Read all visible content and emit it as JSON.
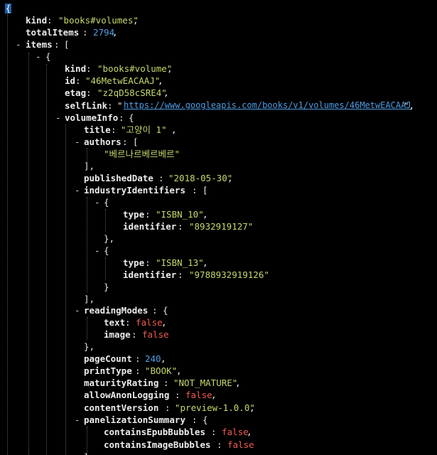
{
  "json": {
    "root_open": "{",
    "kind": {
      "key": "kind",
      "value": "\"books#volumes\""
    },
    "totalItems": {
      "key": "totalItems",
      "value": "2794"
    },
    "items": {
      "key": "items",
      "open": "[",
      "item0": {
        "open": "{",
        "kind": {
          "key": "kind",
          "value": "\"books#volume\""
        },
        "id": {
          "key": "id",
          "value": "\"46MetwEACAAJ\""
        },
        "etag": {
          "key": "etag",
          "value": "\"z2qD58cSRE4\""
        },
        "selfLink": {
          "key": "selfLink",
          "value": "https://www.googleapis.com/books/v1/volumes/46MetwEACAAJ"
        },
        "volumeInfo": {
          "key": "volumeInfo",
          "open": "{",
          "title": {
            "key": "title",
            "value": "\"고양이 1\""
          },
          "authors": {
            "key": "authors",
            "open": "[",
            "values": [
              "\"베르나르베르베르\""
            ],
            "close": "],"
          },
          "publishedDate": {
            "key": "publishedDate",
            "value": "\"2018-05-30\""
          },
          "industryIdentifiers": {
            "key": "industryIdentifiers",
            "open": "[",
            "entries": [
              {
                "open": "{",
                "type_key": "type",
                "type_value": "\"ISBN_10\"",
                "id_key": "identifier",
                "id_value": "\"8932919127\"",
                "close": "},"
              },
              {
                "open": "{",
                "type_key": "type",
                "type_value": "\"ISBN_13\"",
                "id_key": "identifier",
                "id_value": "\"9788932919126\"",
                "close": "}"
              }
            ],
            "close": "],"
          },
          "readingModes": {
            "key": "readingModes",
            "open": "{",
            "text": {
              "key": "text",
              "value": "false"
            },
            "image": {
              "key": "image",
              "value": "false"
            },
            "close": "},"
          },
          "pageCount": {
            "key": "pageCount",
            "value": "240"
          },
          "printType": {
            "key": "printType",
            "value": "\"BOOK\""
          },
          "maturityRating": {
            "key": "maturityRating",
            "value": "\"NOT_MATURE\""
          },
          "allowAnonLogging": {
            "key": "allowAnonLogging",
            "value": "false"
          },
          "contentVersion": {
            "key": "contentVersion",
            "value": "\"preview-1.0.0\""
          },
          "panelizationSummary": {
            "key": "panelizationSummary",
            "open": "{",
            "containsEpubBubbles": {
              "key": "containsEpubBubbles",
              "value": "false"
            },
            "containsImageBubbles": {
              "key": "containsImageBubbles",
              "value": "false"
            },
            "close": "},"
          }
        }
      }
    },
    "collapse_glyph": "-"
  },
  "colors": {
    "background": "#000000",
    "key": "#ececec",
    "string": "#c8d86a",
    "number": "#4e9ee6",
    "boolean": "#f05a4f",
    "link": "#4e9ee6",
    "selection": "#1f5fa8"
  }
}
